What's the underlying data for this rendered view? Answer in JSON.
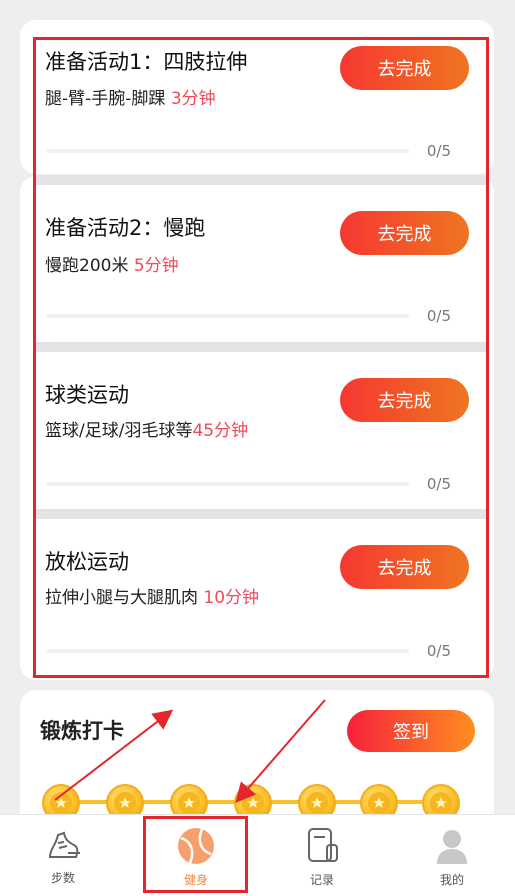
{
  "tasks": [
    {
      "title": "准备活动1：四肢拉伸",
      "subtitle": "腿-臂-手腕-脚踝 ",
      "duration": "3分钟",
      "button": "去完成",
      "progress_text": "0/5",
      "progress": 0
    },
    {
      "title": "准备活动2：慢跑",
      "subtitle": "慢跑200米 ",
      "duration": "5分钟",
      "button": "去完成",
      "progress_text": "0/5",
      "progress": 0
    },
    {
      "title": "球类运动",
      "subtitle": "篮球/足球/羽毛球等",
      "duration": "45分钟",
      "button": "去完成",
      "progress_text": "0/5",
      "progress": 0
    },
    {
      "title": "放松运动",
      "subtitle": "拉伸小腿与大腿肌肉 ",
      "duration": "10分钟",
      "button": "去完成",
      "progress_text": "0/5",
      "progress": 0
    }
  ],
  "checkin": {
    "title": "锻炼打卡",
    "button": "签到"
  },
  "tabs": [
    {
      "label": "步数",
      "icon": "shoe-icon"
    },
    {
      "label": "健身",
      "icon": "ball-icon"
    },
    {
      "label": "记录",
      "icon": "record-icon"
    },
    {
      "label": "我的",
      "icon": "profile-icon"
    }
  ],
  "colors": {
    "accent": "#f53731",
    "duration": "#ee4b5a",
    "active_tab": "#ee8a48",
    "annotation": "#e3262c"
  }
}
